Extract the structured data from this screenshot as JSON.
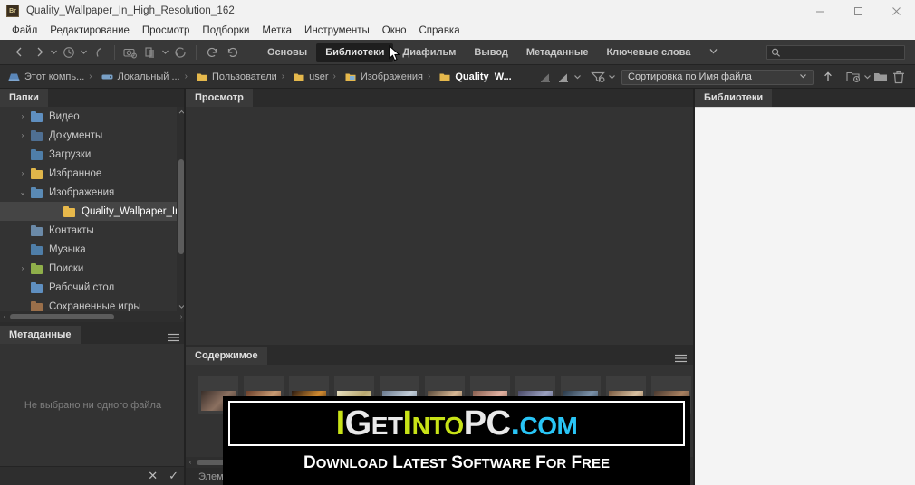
{
  "titlebar": {
    "app_icon_label": "Br",
    "title": "Quality_Wallpaper_In_High_Resolution_162",
    "minimize": "minimize-button",
    "maximize": "maximize-button",
    "close": "close-button"
  },
  "menubar": {
    "items": [
      {
        "label": "Файл"
      },
      {
        "label": "Редактирование"
      },
      {
        "label": "Просмотр"
      },
      {
        "label": "Подборки"
      },
      {
        "label": "Метка"
      },
      {
        "label": "Инструменты"
      },
      {
        "label": "Окно"
      },
      {
        "label": "Справка"
      }
    ]
  },
  "toolbar": {
    "workspaces": [
      {
        "label": "Основы",
        "active": false
      },
      {
        "label": "Библиотеки",
        "active": true
      },
      {
        "label": "Диафильм",
        "active": false
      },
      {
        "label": "Вывод",
        "active": false
      },
      {
        "label": "Метаданные",
        "active": false
      },
      {
        "label": "Ключевые слова",
        "active": false
      }
    ],
    "more_label": "⌄",
    "search": {
      "value": "",
      "placeholder": ""
    }
  },
  "pathbar": {
    "crumbs": [
      {
        "label": "Этот компь...",
        "icon": "computer-icon",
        "current": false
      },
      {
        "label": "Локальный ...",
        "icon": "drive-icon",
        "current": false
      },
      {
        "label": "Пользователи",
        "icon": "folder-icon",
        "current": false
      },
      {
        "label": "user",
        "icon": "folder-icon",
        "current": false
      },
      {
        "label": "Изображения",
        "icon": "pictures-folder-icon",
        "current": false
      },
      {
        "label": "Quality_W...",
        "icon": "folder-icon",
        "current": true
      }
    ],
    "separator": "›",
    "sort_label": "Сортировка по Имя файла",
    "sort_caret": "⌄"
  },
  "panels": {
    "folders": {
      "tab_label": "Папки",
      "tree": [
        {
          "label": "Видео",
          "twisty": "›",
          "indent": 0,
          "selected": false,
          "folder_color": "#5f8fc0"
        },
        {
          "label": "Документы",
          "twisty": "›",
          "indent": 0,
          "selected": false,
          "folder_color": "#4f6f92"
        },
        {
          "label": "Загрузки",
          "twisty": "",
          "indent": 0,
          "selected": false,
          "folder_color": "#4f7ea8"
        },
        {
          "label": "Избранное",
          "twisty": "›",
          "indent": 0,
          "selected": false,
          "folder_color": "#e0b64a"
        },
        {
          "label": "Изображения",
          "twisty": "⌄",
          "indent": 0,
          "selected": false,
          "folder_color": "#5a8ab5"
        },
        {
          "label": "Quality_Wallpaper_In_Hi",
          "twisty": "",
          "indent": 1,
          "selected": true,
          "folder_color": "#e8b94b"
        },
        {
          "label": "Контакты",
          "twisty": "",
          "indent": 0,
          "selected": false,
          "folder_color": "#6b8aa8"
        },
        {
          "label": "Музыка",
          "twisty": "",
          "indent": 0,
          "selected": false,
          "folder_color": "#4f7ea8"
        },
        {
          "label": "Поиски",
          "twisty": "›",
          "indent": 0,
          "selected": false,
          "folder_color": "#8faf4a"
        },
        {
          "label": "Рабочий стол",
          "twisty": "",
          "indent": 0,
          "selected": false,
          "folder_color": "#5f8fc0"
        },
        {
          "label": "Сохраненные игры",
          "twisty": "",
          "indent": 0,
          "selected": false,
          "folder_color": "#9a6f4a"
        }
      ]
    },
    "metadata": {
      "tab_label": "Метаданные",
      "empty_text": "Не выбрано ни одного файла",
      "cancel_glyph": "✕",
      "apply_glyph": "✓"
    },
    "preview": {
      "tab_label": "Просмотр"
    },
    "content": {
      "tab_label": "Содержимое",
      "status_text": "Элеме...",
      "thumbnails": [
        {
          "c1": "#3a2f2a",
          "c2": "#8b7060"
        },
        {
          "c1": "#6b3f2a",
          "c2": "#c89a72"
        },
        {
          "c1": "#2a1a10",
          "c2": "#d08a30"
        },
        {
          "c1": "#e8e0c0",
          "c2": "#b8a870"
        },
        {
          "c1": "#6a7a90",
          "c2": "#c2cdd8"
        },
        {
          "c1": "#5a4a3a",
          "c2": "#d8b894"
        },
        {
          "c1": "#8a6050",
          "c2": "#e0b0a0"
        },
        {
          "c1": "#4a4a68",
          "c2": "#9aa0c0"
        },
        {
          "c1": "#2a3a4a",
          "c2": "#7a90a8"
        },
        {
          "c1": "#7a5a40",
          "c2": "#d8c0a0"
        },
        {
          "c1": "#4a3a30",
          "c2": "#a88060"
        }
      ]
    },
    "libraries": {
      "tab_label": "Библиотеки"
    }
  },
  "watermark": {
    "line1_parts": [
      {
        "text": "I",
        "color_class": "c1",
        "size": "lg"
      },
      {
        "text": "G",
        "color_class": "c2",
        "size": "lg"
      },
      {
        "text": "ET",
        "color_class": "c2",
        "size": "sm"
      },
      {
        "text": "I",
        "color_class": "c1",
        "size": "lg"
      },
      {
        "text": "NTO",
        "color_class": "c1",
        "size": "sm"
      },
      {
        "text": "PC",
        "color_class": "c2",
        "size": "lg"
      },
      {
        "text": ".",
        "color_class": "c3",
        "size": "lg"
      },
      {
        "text": "COM",
        "color_class": "c3",
        "size": "sm"
      }
    ],
    "line1_plain": "IGetIntoPC.com",
    "line2": "Download Latest Software for Free"
  },
  "colors": {
    "chrome_bg": "#2b2b2b",
    "panel_bg": "#333333",
    "toolbar_bg": "#383838",
    "titlebar_bg": "#f2f2f2",
    "accent_selected": "#454545",
    "library_panel_bg": "#f4f4f4",
    "watermark_green": "#c8e317",
    "watermark_cyan": "#29c5f6"
  }
}
